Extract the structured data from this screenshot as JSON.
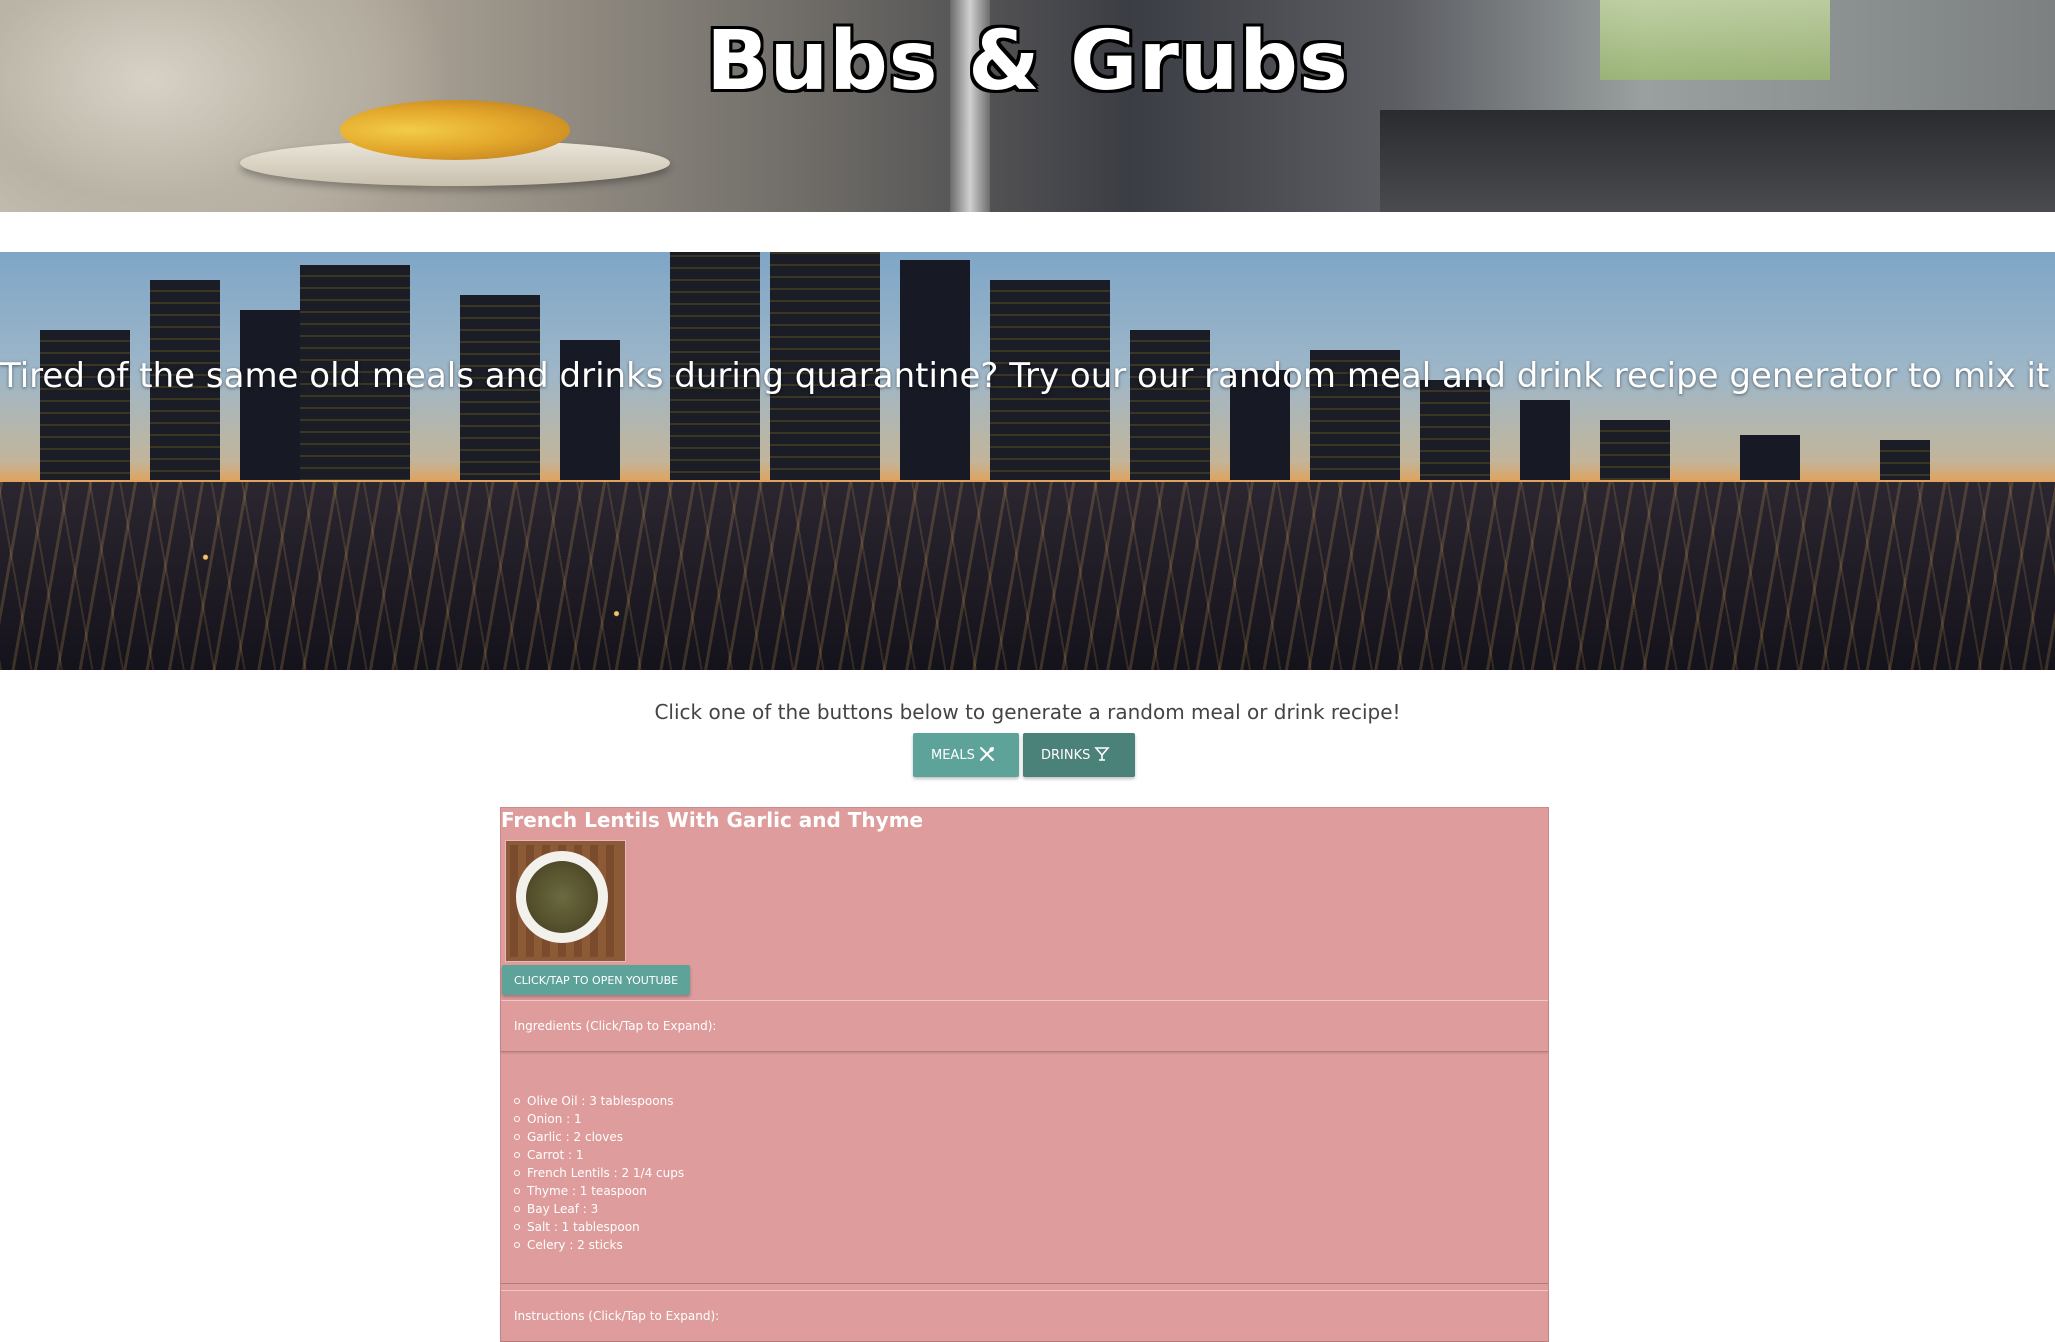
{
  "header": {
    "title": "Bubs & Grubs"
  },
  "hero": {
    "tagline": "Tired of the same old meals and drinks during quarantine? Try our our random meal and drink recipe generator to mix it up!"
  },
  "prompt": {
    "text": "Click one of the buttons below to generate a random meal or drink recipe!"
  },
  "buttons": {
    "meals_label": "MEALS",
    "meals_icon": "utensils-icon",
    "drinks_label": "DRINKS",
    "drinks_icon": "cocktail-icon"
  },
  "recipe": {
    "title": "French Lentils With Garlic and Thyme",
    "youtube_label": "CLICK/TAP TO OPEN YOUTUBE",
    "ingredients_header": "Ingredients (Click/Tap to Expand):",
    "ingredients": [
      "Olive Oil : 3 tablespoons",
      "Onion : 1",
      "Garlic : 2 cloves",
      "Carrot : 1",
      "French Lentils : 2 1/4 cups",
      "Thyme : 1 teaspoon",
      "Bay Leaf : 3",
      "Salt : 1 tablespoon",
      "Celery : 2 sticks"
    ],
    "instructions_header": "Instructions (Click/Tap to Expand):"
  },
  "colors": {
    "card_background": "#de9c9c",
    "meals_button": "#5ea39a",
    "drinks_button": "#4a8179"
  }
}
